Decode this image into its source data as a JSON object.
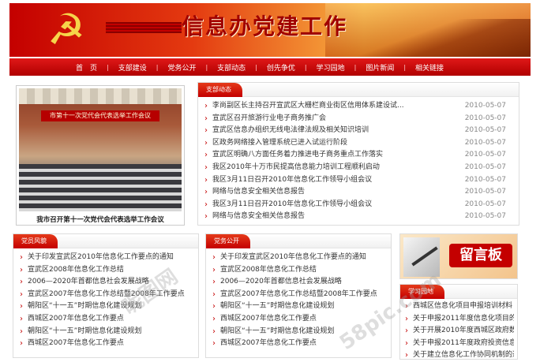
{
  "banner": {
    "title": "信息办党建工作",
    "emblem": "☭"
  },
  "nav": [
    "首　页",
    "支部建设",
    "党务公开",
    "支部动态",
    "创先争优",
    "学习园地",
    "图片新闻",
    "相关链接"
  ],
  "photo": {
    "banner_text": "市第十一次党代会代表选举工作会议",
    "caption": "我市召开第十一次党代会代表选举工作会议"
  },
  "dynamics": {
    "title": "支部动态",
    "items": [
      {
        "text": "李尚副区长主持召开宣武区大栅栏商业街区信用体系建设试...",
        "date": "2010-05-07"
      },
      {
        "text": "宣武区召开旅游行业电子商务推广会",
        "date": "2010-05-07"
      },
      {
        "text": "宣武区信息办组织无线电法律法规及相关知识培训",
        "date": "2010-05-07"
      },
      {
        "text": "区政务网络接入管理系统已进入试运行阶段",
        "date": "2010-05-07"
      },
      {
        "text": "宣武区明确八方面任务着力推进电子商务重点工作落实",
        "date": "2010-05-07"
      },
      {
        "text": "我区2010年十万市民提高信息能力培训工程顺利启动",
        "date": "2010-05-07"
      },
      {
        "text": "我区3月11日召开2010年信息化工作领导小组会议",
        "date": "2010-05-07"
      },
      {
        "text": "网络与信息安全相关信息报告",
        "date": "2010-05-07"
      },
      {
        "text": "我区3月11日召开2010年信息化工作领导小组会议",
        "date": "2010-05-07"
      },
      {
        "text": "网络与信息安全相关信息报告",
        "date": "2010-05-07"
      }
    ]
  },
  "party_build": {
    "title": "党员风貌",
    "items": [
      "关于印发宣武区2010年信息化工作要点的通知",
      "宣武区2008年信息化工作总结",
      "2006—2020年首都信息社会发展战略",
      "宣武区2007年信息化工作总结暨2008年工作要点",
      "朝阳区“十一五”时期信息化建设规划",
      "西城区2007年信息化工作要点",
      "朝阳区“十一五”时期信息化建设规划",
      "西城区2007年信息化工作要点"
    ]
  },
  "party_affairs": {
    "title": "党务公开",
    "items": [
      "关于印发宣武区2010年信息化工作要点的通知",
      "宣武区2008年信息化工作总结",
      "2006—2020年首都信息社会发展战略",
      "宣武区2007年信息化工作总结暨2008年工作要点",
      "朝阳区“十一五”时期信息化建设规划",
      "西城区2007年信息化工作要点",
      "朝阳区“十一五”时期信息化建设规划",
      "西城区2007年信息化工作要点"
    ]
  },
  "guestbook": {
    "label": "留言板"
  },
  "study": {
    "title": "学习园地",
    "items": [
      "西城区信息化项目申报培训材料",
      "关于申报2011年度信息化项目的通...",
      "关于开展2010年度西城区政府数字主...",
      "关于申报2011年度政府投资信息化...",
      "关于建立信息化工作协同机制的通知"
    ]
  },
  "watermarks": [
    "昵图网",
    "58pic.com"
  ]
}
